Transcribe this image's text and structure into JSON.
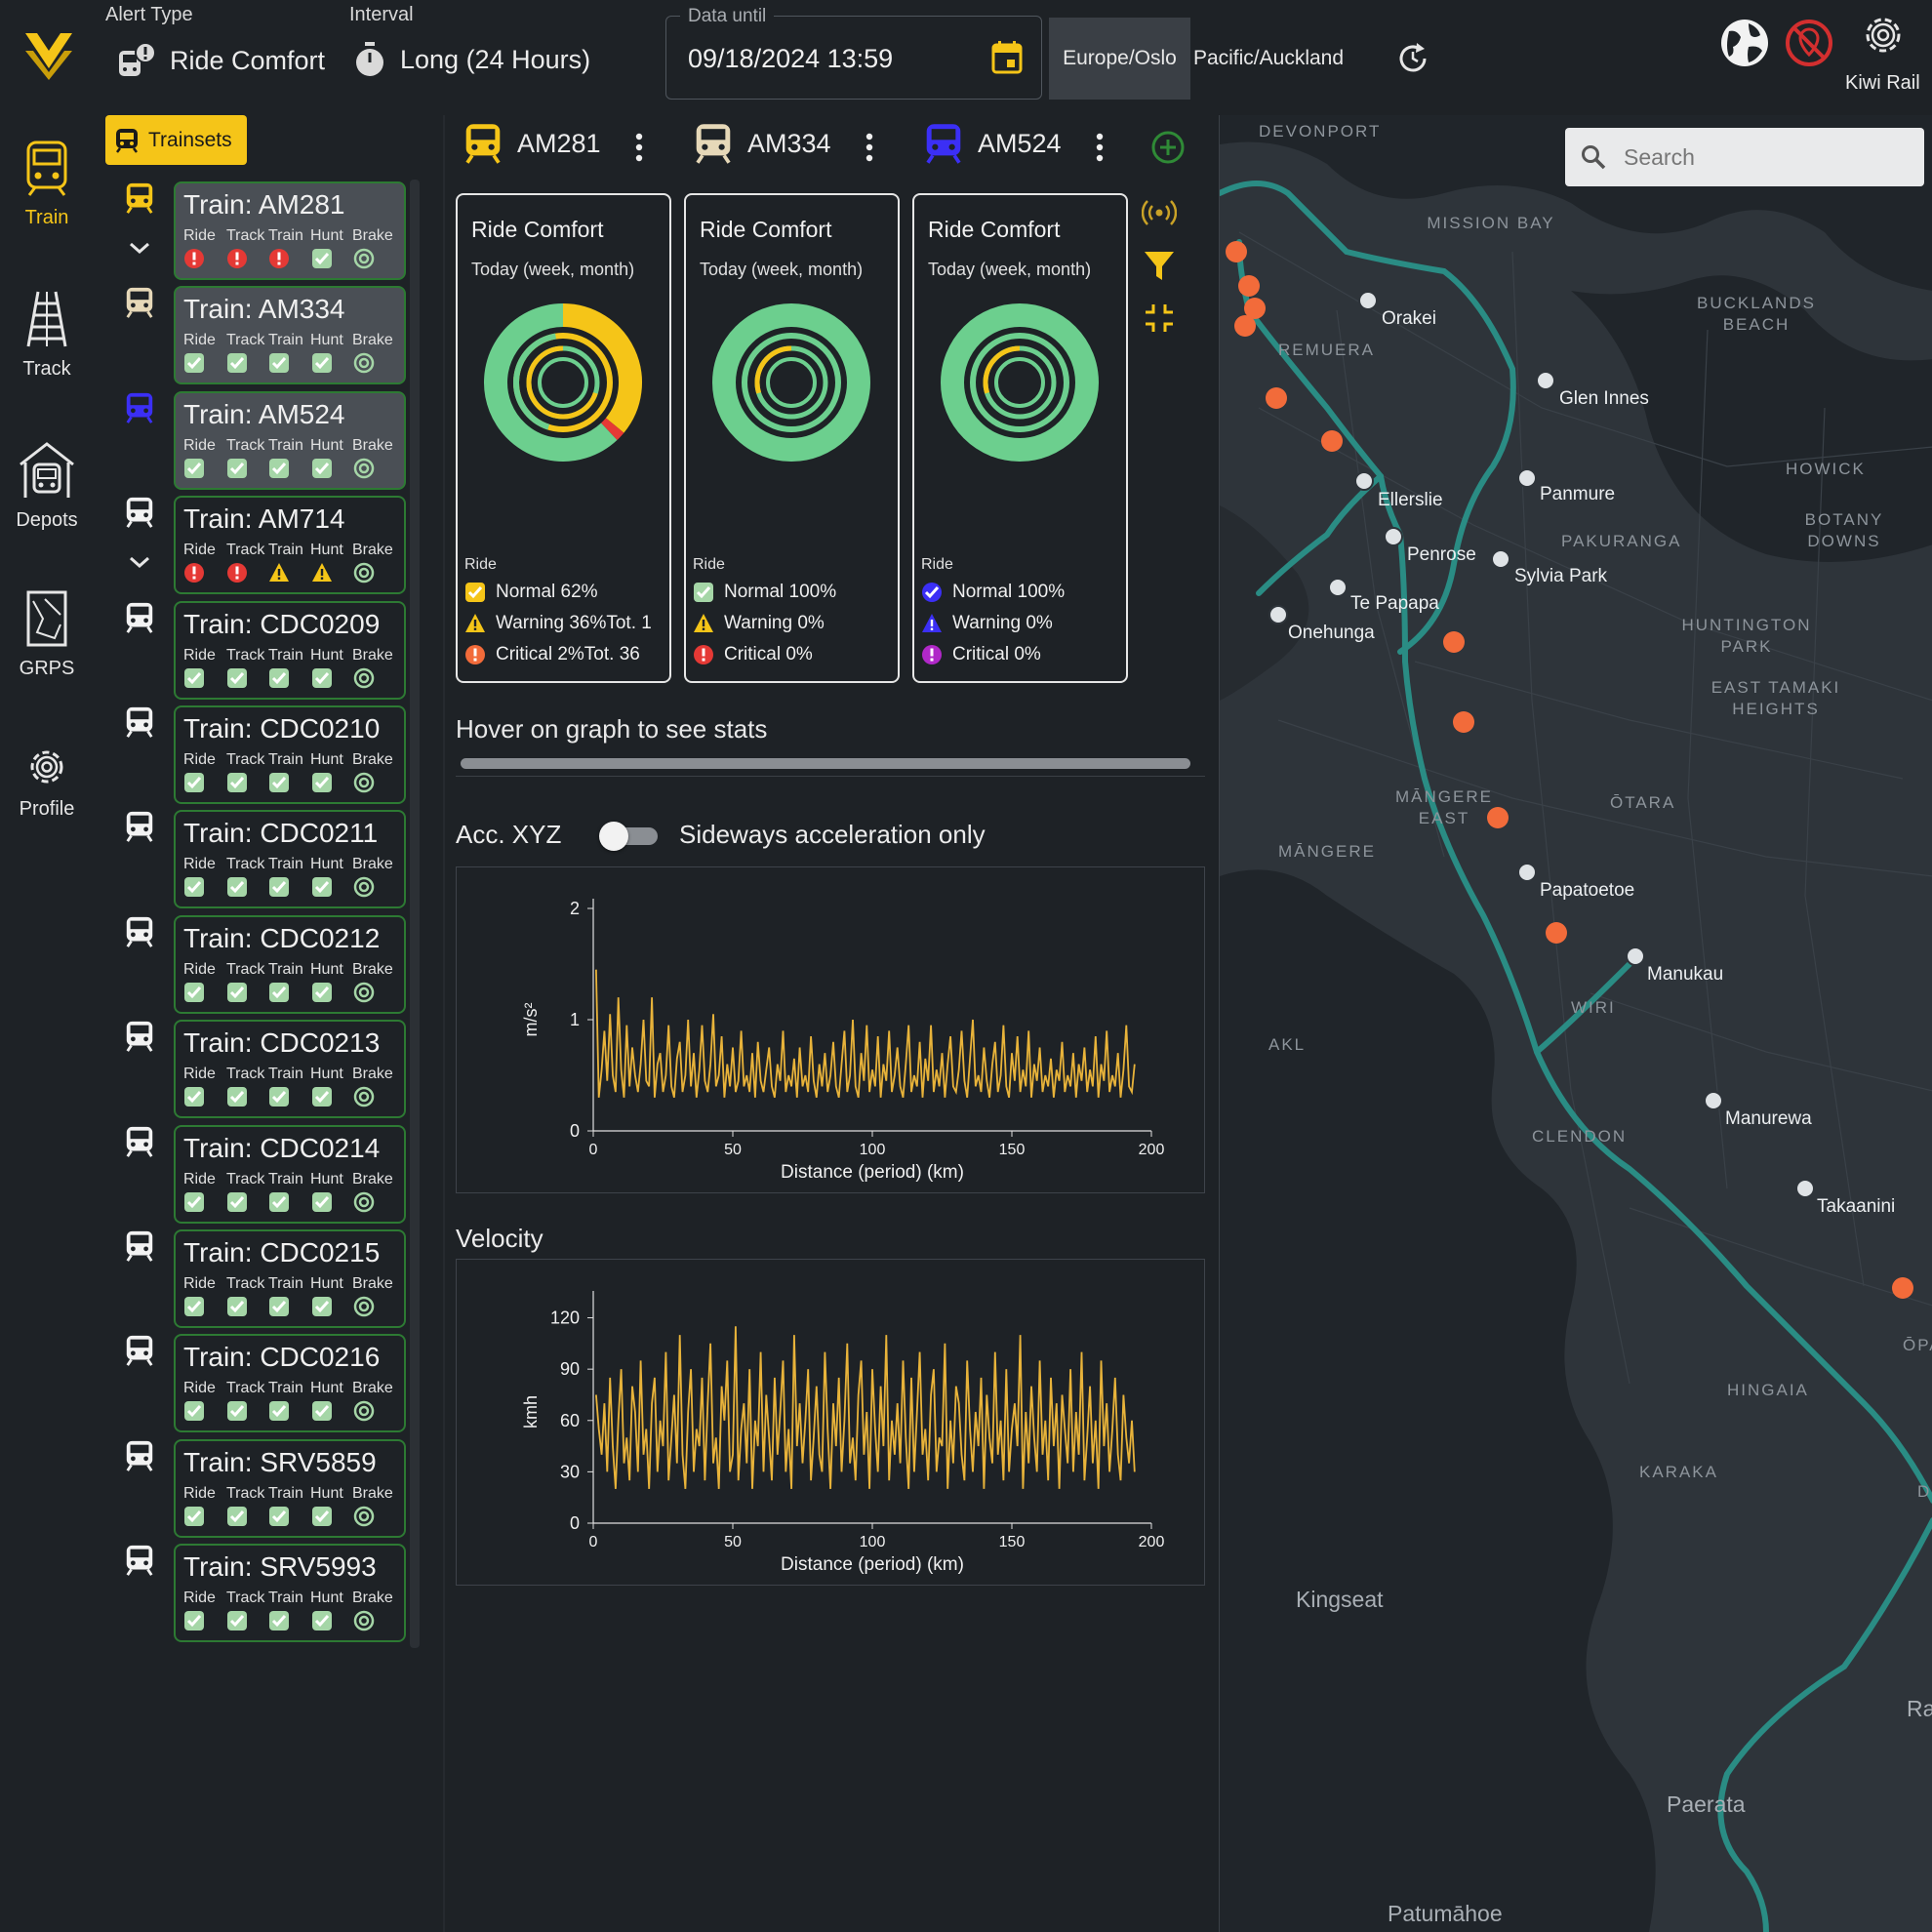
{
  "header": {
    "alert_type_label": "Alert Type",
    "alert_type_value": "Ride Comfort",
    "interval_label": "Interval",
    "interval_value": "Long (24 Hours)",
    "data_until_label": "Data until",
    "data_until_value": "09/18/2024 13:59",
    "timezones": [
      "Europe/Oslo",
      "Pacific/Auckland"
    ],
    "selected_timezone": "Europe/Oslo",
    "org_name": "Kiwi Rail"
  },
  "nav": {
    "items": [
      {
        "label": "Train",
        "icon": "train-icon",
        "active": true
      },
      {
        "label": "Track",
        "icon": "track-icon",
        "active": false
      },
      {
        "label": "Depots",
        "icon": "depot-icon",
        "active": false
      },
      {
        "label": "GRPS",
        "icon": "grps-icon",
        "active": false
      },
      {
        "label": "Profile",
        "icon": "gear-icon",
        "active": false
      }
    ]
  },
  "trainsets": {
    "label": "Trainsets",
    "column_labels": [
      "Ride",
      "Track",
      "Train",
      "Hunt",
      "Brake"
    ],
    "items": [
      {
        "name": "Train: AM281",
        "selected": true,
        "color": "#f5c518",
        "status": [
          "critical",
          "critical",
          "critical",
          "ok",
          "target"
        ],
        "expand": true
      },
      {
        "name": "Train: AM334",
        "selected": true,
        "color": "#e6d8b8",
        "status": [
          "ok",
          "ok",
          "ok",
          "ok",
          "target"
        ],
        "expand": false
      },
      {
        "name": "Train: AM524",
        "selected": true,
        "color": "#3b2ff5",
        "status": [
          "ok",
          "ok",
          "ok",
          "ok",
          "target"
        ],
        "expand": false
      },
      {
        "name": "Train: AM714",
        "selected": false,
        "color": "#f2f2f2",
        "status": [
          "critical",
          "critical",
          "warning",
          "warning",
          "target"
        ],
        "expand": true
      },
      {
        "name": "Train: CDC0209",
        "selected": false,
        "color": "#f2f2f2",
        "status": [
          "ok",
          "ok",
          "ok",
          "ok",
          "target"
        ],
        "expand": false
      },
      {
        "name": "Train: CDC0210",
        "selected": false,
        "color": "#f2f2f2",
        "status": [
          "ok",
          "ok",
          "ok",
          "ok",
          "target"
        ],
        "expand": false
      },
      {
        "name": "Train: CDC0211",
        "selected": false,
        "color": "#f2f2f2",
        "status": [
          "ok",
          "ok",
          "ok",
          "ok",
          "target"
        ],
        "expand": false
      },
      {
        "name": "Train: CDC0212",
        "selected": false,
        "color": "#f2f2f2",
        "status": [
          "ok",
          "ok",
          "ok",
          "ok",
          "target"
        ],
        "expand": false
      },
      {
        "name": "Train: CDC0213",
        "selected": false,
        "color": "#f2f2f2",
        "status": [
          "ok",
          "ok",
          "ok",
          "ok",
          "target"
        ],
        "expand": false
      },
      {
        "name": "Train: CDC0214",
        "selected": false,
        "color": "#f2f2f2",
        "status": [
          "ok",
          "ok",
          "ok",
          "ok",
          "target"
        ],
        "expand": false
      },
      {
        "name": "Train: CDC0215",
        "selected": false,
        "color": "#f2f2f2",
        "status": [
          "ok",
          "ok",
          "ok",
          "ok",
          "target"
        ],
        "expand": false
      },
      {
        "name": "Train: CDC0216",
        "selected": false,
        "color": "#f2f2f2",
        "status": [
          "ok",
          "ok",
          "ok",
          "ok",
          "target"
        ],
        "expand": false
      },
      {
        "name": "Train: SRV5859",
        "selected": false,
        "color": "#f2f2f2",
        "status": [
          "ok",
          "ok",
          "ok",
          "ok",
          "target"
        ],
        "expand": false
      },
      {
        "name": "Train: SRV5993",
        "selected": false,
        "color": "#f2f2f2",
        "status": [
          "ok",
          "ok",
          "ok",
          "ok",
          "target"
        ],
        "expand": false
      }
    ]
  },
  "tabs": [
    {
      "label": "AM281",
      "color": "#f5c518"
    },
    {
      "label": "AM334",
      "color": "#e6d8b8"
    },
    {
      "label": "AM524",
      "color": "#3b2ff5"
    }
  ],
  "cards": [
    {
      "title": "Ride Comfort",
      "subtitle": "Today (week, month)",
      "ride_label": "Ride",
      "normal": "Normal 62%",
      "warning": "Warning 36%Tot. 1",
      "critical": "Critical 2%Tot. 36",
      "normal_frac": 0.62,
      "warning_frac": 0.36,
      "critical_frac": 0.02,
      "inner_frac": 0.7,
      "legend_icon_color": "#f5c518"
    },
    {
      "title": "Ride Comfort",
      "subtitle": "Today (week, month)",
      "ride_label": "Ride",
      "normal": "Normal 100%",
      "warning": "Warning 0%",
      "critical": "Critical 0%",
      "normal_frac": 1.0,
      "warning_frac": 0.0,
      "critical_frac": 0.0,
      "inner_frac": 0.3,
      "legend_icon_color": "#e6d8b8"
    },
    {
      "title": "Ride Comfort",
      "subtitle": "Today (week, month)",
      "ride_label": "Ride",
      "normal": "Normal 100%",
      "warning": "Warning 0%",
      "critical": "Critical 0%",
      "normal_frac": 1.0,
      "warning_frac": 0.0,
      "critical_frac": 0.0,
      "inner_frac": 0.3,
      "legend_icon_color": "#3b2ff5"
    }
  ],
  "hover_hint": "Hover on graph to see stats",
  "acc": {
    "title": "Acc. XYZ",
    "toggle_label": "Sideways acceleration only",
    "toggle_on": false
  },
  "velocity": {
    "title": "Velocity"
  },
  "chart_data": [
    {
      "type": "line",
      "title": "",
      "xlabel": "Distance (period) (km)",
      "ylabel": "m/s²",
      "xlim": [
        0,
        200
      ],
      "ylim": [
        0,
        2
      ],
      "xticks": [
        0,
        50,
        100,
        150,
        200
      ],
      "yticks": [
        0,
        1,
        2
      ],
      "color": "#e8b33a",
      "x": [
        1,
        2,
        3,
        4,
        5,
        6,
        7,
        8,
        9,
        10,
        11,
        12,
        13,
        14,
        15,
        16,
        17,
        18,
        19,
        20,
        21,
        22,
        23,
        24,
        25,
        26,
        27,
        28,
        29,
        30,
        31,
        32,
        33,
        34,
        35,
        36,
        37,
        38,
        39,
        40,
        41,
        42,
        43,
        44,
        45,
        46,
        47,
        48,
        49,
        50,
        51,
        52,
        53,
        54,
        55,
        56,
        57,
        58,
        59,
        60,
        61,
        62,
        63,
        64,
        65,
        66,
        67,
        68,
        69,
        70,
        71,
        72,
        73,
        74,
        75,
        76,
        77,
        78,
        79,
        80,
        81,
        82,
        83,
        84,
        85,
        86,
        87,
        88,
        89,
        90,
        91,
        92,
        93,
        94,
        95,
        96,
        97,
        98,
        99,
        100,
        101,
        102,
        103,
        104,
        105,
        106,
        107,
        108,
        109,
        110,
        111,
        112,
        113,
        114,
        115,
        116,
        117,
        118,
        119,
        120,
        121,
        122,
        123,
        124,
        125,
        126,
        127,
        128,
        129,
        130,
        131,
        132,
        133,
        134,
        135,
        136,
        137,
        138,
        139,
        140,
        141,
        142,
        143,
        144,
        145,
        146,
        147,
        148,
        149,
        150,
        151,
        152,
        153,
        154,
        155,
        156,
        157,
        158,
        159,
        160,
        161,
        162,
        163,
        164,
        165,
        166,
        167,
        168,
        169,
        170,
        171,
        172,
        173,
        174,
        175,
        176,
        177,
        178,
        179,
        180,
        181,
        182,
        183,
        184,
        185,
        186,
        187,
        188,
        189,
        190,
        191,
        192,
        193,
        194
      ],
      "y": [
        1.45,
        0.3,
        0.55,
        0.9,
        0.45,
        1.05,
        0.5,
        0.35,
        1.2,
        0.55,
        0.3,
        0.95,
        0.4,
        0.75,
        0.5,
        0.35,
        0.6,
        1.0,
        0.45,
        0.4,
        1.2,
        0.3,
        0.6,
        0.7,
        0.35,
        0.5,
        0.95,
        0.4,
        0.3,
        0.65,
        0.8,
        0.35,
        0.5,
        1.0,
        0.4,
        0.7,
        0.3,
        0.55,
        0.95,
        0.45,
        0.35,
        0.6,
        1.05,
        0.4,
        0.5,
        0.85,
        0.3,
        0.6,
        0.4,
        0.75,
        0.35,
        0.45,
        0.9,
        0.4,
        0.5,
        0.35,
        0.7,
        0.3,
        0.8,
        0.45,
        0.35,
        0.55,
        0.75,
        0.4,
        0.3,
        0.6,
        0.45,
        0.9,
        0.35,
        0.5,
        0.4,
        0.65,
        0.3,
        0.75,
        0.4,
        0.5,
        0.35,
        0.85,
        0.45,
        0.3,
        0.6,
        0.4,
        0.7,
        0.35,
        0.5,
        0.8,
        0.4,
        0.3,
        0.6,
        0.9,
        0.35,
        0.5,
        1.0,
        0.4,
        0.3,
        0.7,
        0.45,
        0.95,
        0.35,
        0.55,
        0.4,
        0.85,
        0.3,
        0.6,
        0.45,
        0.9,
        0.35,
        0.5,
        0.75,
        0.4,
        0.3,
        0.6,
        0.95,
        0.35,
        0.5,
        0.4,
        0.8,
        0.3,
        0.65,
        0.45,
        0.95,
        0.35,
        0.55,
        0.4,
        0.7,
        0.3,
        0.6,
        0.85,
        0.4,
        0.35,
        0.55,
        0.9,
        0.45,
        0.3,
        0.65,
        1.0,
        0.4,
        0.5,
        0.35,
        0.75,
        0.45,
        0.3,
        0.6,
        0.8,
        0.35,
        0.5,
        0.95,
        0.4,
        0.3,
        0.7,
        0.45,
        0.85,
        0.35,
        0.55,
        0.4,
        0.9,
        0.3,
        0.6,
        0.45,
        0.75,
        0.35,
        0.5,
        0.4,
        0.65,
        0.3,
        0.55,
        0.45,
        0.8,
        0.35,
        0.5,
        0.4,
        0.7,
        0.3,
        0.6,
        0.45,
        0.75,
        0.35,
        0.55,
        0.4,
        0.85,
        0.3,
        0.6,
        0.45,
        0.9,
        0.35,
        0.5,
        0.4,
        0.7,
        0.3,
        0.55,
        0.95,
        0.4,
        0.35,
        0.6,
        0.85,
        0.5,
        1.0
      ]
    },
    {
      "type": "line",
      "title": "",
      "xlabel": "Distance (period) (km)",
      "ylabel": "kmh",
      "xlim": [
        0,
        200
      ],
      "ylim": [
        0,
        130
      ],
      "xticks": [
        0,
        50,
        100,
        150,
        200
      ],
      "yticks": [
        0,
        30,
        60,
        90,
        120
      ],
      "color": "#e8b33a",
      "x": [
        1,
        2,
        3,
        4,
        5,
        6,
        7,
        8,
        9,
        10,
        11,
        12,
        13,
        14,
        15,
        16,
        17,
        18,
        19,
        20,
        21,
        22,
        23,
        24,
        25,
        26,
        27,
        28,
        29,
        30,
        31,
        32,
        33,
        34,
        35,
        36,
        37,
        38,
        39,
        40,
        41,
        42,
        43,
        44,
        45,
        46,
        47,
        48,
        49,
        50,
        51,
        52,
        53,
        54,
        55,
        56,
        57,
        58,
        59,
        60,
        61,
        62,
        63,
        64,
        65,
        66,
        67,
        68,
        69,
        70,
        71,
        72,
        73,
        74,
        75,
        76,
        77,
        78,
        79,
        80,
        81,
        82,
        83,
        84,
        85,
        86,
        87,
        88,
        89,
        90,
        91,
        92,
        93,
        94,
        95,
        96,
        97,
        98,
        99,
        100,
        101,
        102,
        103,
        104,
        105,
        106,
        107,
        108,
        109,
        110,
        111,
        112,
        113,
        114,
        115,
        116,
        117,
        118,
        119,
        120,
        121,
        122,
        123,
        124,
        125,
        126,
        127,
        128,
        129,
        130,
        131,
        132,
        133,
        134,
        135,
        136,
        137,
        138,
        139,
        140,
        141,
        142,
        143,
        144,
        145,
        146,
        147,
        148,
        149,
        150,
        151,
        152,
        153,
        154,
        155,
        156,
        157,
        158,
        159,
        160,
        161,
        162,
        163,
        164,
        165,
        166,
        167,
        168,
        169,
        170,
        171,
        172,
        173,
        174,
        175,
        176,
        177,
        178,
        179,
        180,
        181,
        182,
        183,
        184,
        185,
        186,
        187,
        188,
        189,
        190,
        191,
        192,
        193,
        194
      ],
      "y": [
        75,
        55,
        40,
        70,
        30,
        85,
        45,
        20,
        60,
        90,
        35,
        50,
        25,
        80,
        65,
        30,
        95,
        40,
        55,
        20,
        70,
        85,
        30,
        60,
        45,
        100,
        25,
        50,
        75,
        35,
        110,
        40,
        20,
        65,
        90,
        30,
        55,
        45,
        85,
        25,
        70,
        105,
        35,
        50,
        20,
        80,
        60,
        95,
        30,
        40,
        115,
        25,
        55,
        70,
        35,
        90,
        20,
        60,
        45,
        100,
        30,
        75,
        50,
        25,
        85,
        40,
        65,
        95,
        30,
        55,
        20,
        110,
        45,
        70,
        35,
        60,
        90,
        25,
        50,
        80,
        40,
        30,
        100,
        55,
        20,
        70,
        45,
        85,
        30,
        60,
        105,
        35,
        50,
        25,
        75,
        95,
        40,
        65,
        20,
        90,
        55,
        30,
        80,
        45,
        110,
        25,
        60,
        40,
        70,
        35,
        95,
        50,
        20,
        85,
        30,
        65,
        100,
        40,
        55,
        25,
        75,
        90,
        30,
        50,
        45,
        105,
        20,
        60,
        35,
        80,
        70,
        40,
        25,
        95,
        55,
        30,
        65,
        45,
        85,
        20,
        75,
        50,
        35,
        100,
        40,
        60,
        25,
        90,
        30,
        55,
        70,
        45,
        110,
        20,
        65,
        35,
        80,
        50,
        30,
        95,
        40,
        60,
        25,
        85,
        45,
        70,
        20,
        75,
        55,
        35,
        90,
        30,
        65,
        40,
        100,
        25,
        50,
        80,
        35,
        60,
        20,
        95,
        45,
        70,
        30,
        55,
        85,
        40,
        25,
        75,
        50,
        35,
        60,
        30
      ]
    }
  ],
  "map": {
    "search_placeholder": "Search",
    "area_labels": [
      {
        "text": "DEVONPORT"
      },
      {
        "text": "MISSION BAY"
      },
      {
        "text": "BUCKLANDS BEACH"
      },
      {
        "text": "REMUERA"
      },
      {
        "text": "HOWICK"
      },
      {
        "text": "PAKURANGA"
      },
      {
        "text": "BOTANY DOWNS"
      },
      {
        "text": "HUNTINGTON PARK"
      },
      {
        "text": "EAST TAMAKI HEIGHTS"
      },
      {
        "text": "MĀNGERE EAST"
      },
      {
        "text": "ŌTARA"
      },
      {
        "text": "MĀNGERE"
      },
      {
        "text": "WIRI"
      },
      {
        "text": "AKL"
      },
      {
        "text": "CLENDON"
      },
      {
        "text": "HINGAIA"
      },
      {
        "text": "KARAKA"
      },
      {
        "text": "ŌPAH"
      },
      {
        "text": "DRU"
      }
    ],
    "stations": [
      "Orakei",
      "Glen Innes",
      "Panmure",
      "Ellerslie",
      "Penrose",
      "Sylvia Park",
      "Te Papapa",
      "Onehunga",
      "Papatoetoe",
      "Manukau",
      "Manurewa",
      "Takaanini"
    ],
    "places": [
      "Kingseat",
      "Paerata",
      "Patumāhoe",
      "Ra"
    ]
  }
}
